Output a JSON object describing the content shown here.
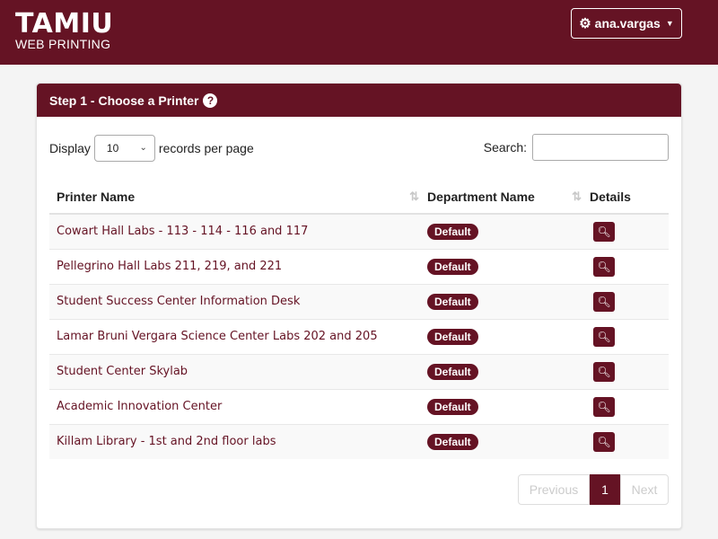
{
  "header": {
    "brand_name": "TAMIU",
    "brand_sub": "WEB PRINTING",
    "user_label": "ana.vargas",
    "user_icon": "gear-icon"
  },
  "panel": {
    "title": "Step 1 - Choose a Printer",
    "help_glyph": "?"
  },
  "controls": {
    "display_label": "Display",
    "page_size": "10",
    "records_label": "records per page",
    "search_label": "Search:",
    "search_value": ""
  },
  "table": {
    "columns": [
      "Printer Name",
      "Department Name",
      "Details"
    ],
    "rows": [
      {
        "printer": "Cowart Hall Labs - 113 - 114 - 116 and 117",
        "department": "Default"
      },
      {
        "printer": "Pellegrino Hall Labs 211, 219, and 221",
        "department": "Default"
      },
      {
        "printer": "Student Success Center Information Desk",
        "department": "Default"
      },
      {
        "printer": "Lamar Bruni Vergara Science Center Labs 202 and 205",
        "department": "Default"
      },
      {
        "printer": "Student Center Skylab",
        "department": "Default"
      },
      {
        "printer": "Academic Innovation Center",
        "department": "Default"
      },
      {
        "printer": "Killam Library - 1st and 2nd floor labs",
        "department": "Default"
      }
    ]
  },
  "pagination": {
    "previous": "Previous",
    "current": "1",
    "next": "Next"
  },
  "colors": {
    "brand": "#651324"
  }
}
